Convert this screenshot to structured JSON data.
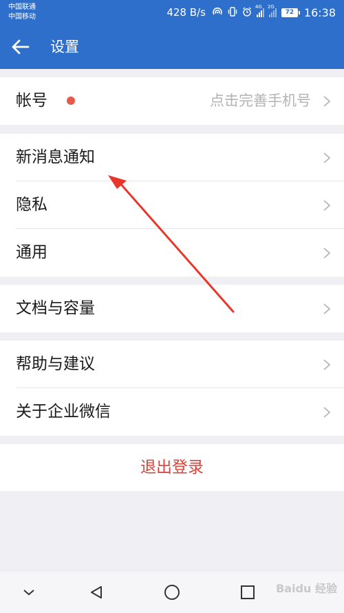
{
  "status_bar": {
    "carrier1": "中国联通",
    "carrier2": "中国移动",
    "speed": "428 B/s",
    "signal1_tag": "4G",
    "signal2_tag": "2G",
    "battery": "72",
    "time": "16:38"
  },
  "title_bar": {
    "back_icon": "arrow-left-icon",
    "title": "设置"
  },
  "groups": [
    {
      "items": [
        {
          "label": "帐号",
          "hint": "点击完善手机号",
          "badge": "red-dot"
        }
      ]
    },
    {
      "items": [
        {
          "label": "新消息通知"
        },
        {
          "label": "隐私"
        },
        {
          "label": "通用"
        }
      ]
    },
    {
      "items": [
        {
          "label": "文档与容量"
        }
      ]
    },
    {
      "items": [
        {
          "label": "帮助与建议"
        },
        {
          "label": "关于企业微信"
        }
      ]
    }
  ],
  "logout": {
    "label": "退出登录"
  },
  "nav_bar": {
    "icons": [
      "chevron-down-icon",
      "back-triangle-icon",
      "home-circle-icon",
      "recent-square-icon"
    ]
  },
  "watermark": "Baidu 经验",
  "colors": {
    "primary": "#2f6fcc",
    "background": "#efeff4",
    "logout_red": "#d8433a",
    "badge_red": "#e65a4c",
    "arrow_red": "#e8362b"
  }
}
